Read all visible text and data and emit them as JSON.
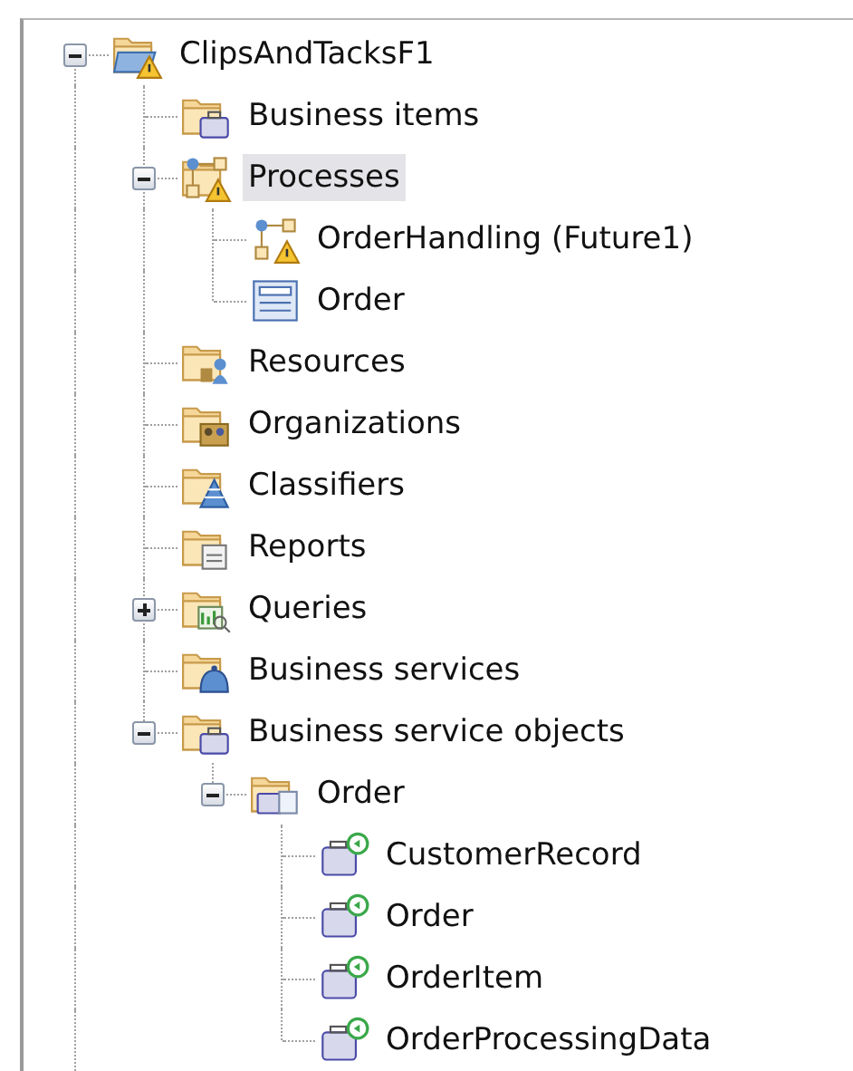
{
  "tree": [
    {
      "label": "ClipsAndTacksF1",
      "kind": "project",
      "warning": true,
      "expanded": true,
      "selected": false,
      "children": [
        {
          "label": "Business items",
          "kind": "items",
          "warning": false,
          "selected": false
        },
        {
          "label": "Processes",
          "kind": "processes",
          "warning": true,
          "expanded": true,
          "selected": true,
          "children": [
            {
              "label": "OrderHandling (Future1)",
              "kind": "process",
              "warning": true,
              "selected": false
            },
            {
              "label": "Order",
              "kind": "form",
              "warning": false,
              "selected": false
            }
          ]
        },
        {
          "label": "Resources",
          "kind": "resources",
          "warning": false,
          "selected": false
        },
        {
          "label": "Organizations",
          "kind": "organizations",
          "warning": false,
          "selected": false
        },
        {
          "label": "Classifiers",
          "kind": "classifiers",
          "warning": false,
          "selected": false
        },
        {
          "label": "Reports",
          "kind": "reports",
          "warning": false,
          "selected": false
        },
        {
          "label": "Queries",
          "kind": "queries",
          "warning": false,
          "expanded": false,
          "selected": false
        },
        {
          "label": "Business services",
          "kind": "services",
          "warning": false,
          "selected": false
        },
        {
          "label": "Business service objects",
          "kind": "objects",
          "warning": false,
          "expanded": true,
          "selected": false,
          "children": [
            {
              "label": "Order",
              "kind": "package",
              "warning": false,
              "expanded": true,
              "selected": false,
              "children": [
                {
                  "label": "CustomerRecord",
                  "kind": "object",
                  "warning": false,
                  "selected": false
                },
                {
                  "label": "Order",
                  "kind": "object",
                  "warning": false,
                  "selected": false
                },
                {
                  "label": "OrderItem",
                  "kind": "object",
                  "warning": false,
                  "selected": false
                },
                {
                  "label": "OrderProcessingData",
                  "kind": "object",
                  "warning": false,
                  "selected": false
                }
              ]
            }
          ]
        }
      ]
    }
  ]
}
